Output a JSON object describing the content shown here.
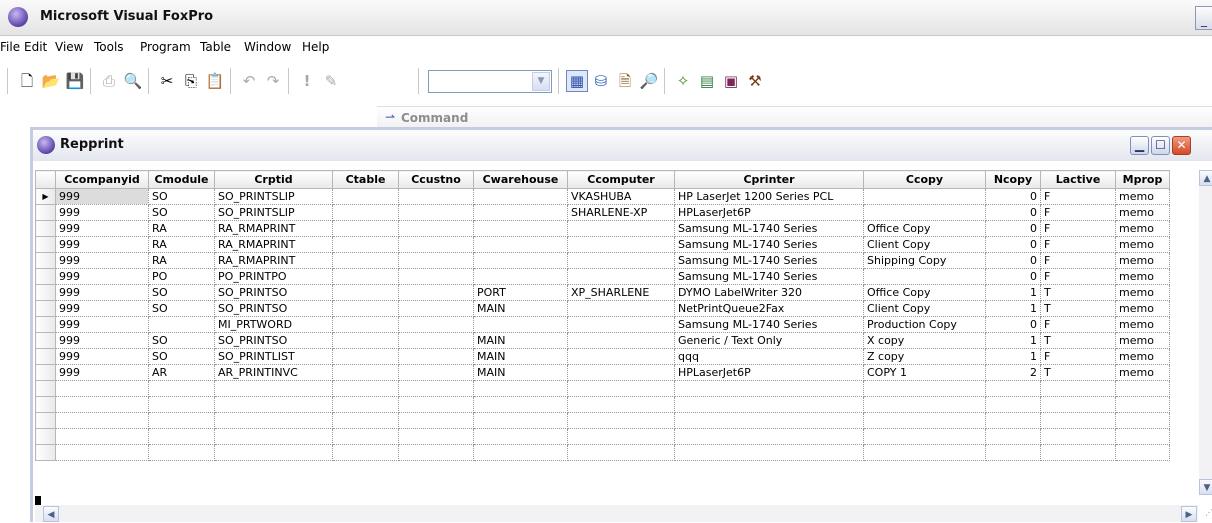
{
  "app": {
    "title": "Microsoft Visual FoxPro"
  },
  "menu": [
    "File",
    "Edit",
    "View",
    "Tools",
    "Program",
    "Table",
    "Window",
    "Help"
  ],
  "command": {
    "label": "Command"
  },
  "browse": {
    "title": "Repprint",
    "columns": [
      "Ccompanyid",
      "Cmodule",
      "Crptid",
      "Ctable",
      "Ccustno",
      "Cwarehouse",
      "Ccomputer",
      "Cprinter",
      "Ccopy",
      "Ncopy",
      "Lactive",
      "Mprop"
    ],
    "rows": [
      [
        "999",
        "SO",
        "SO_PRINTSLIP",
        "",
        "",
        "",
        "VKASHUBA",
        "HP LaserJet 1200 Series PCL",
        "",
        "0",
        "F",
        "memo"
      ],
      [
        "999",
        "SO",
        "SO_PRINTSLIP",
        "",
        "",
        "",
        "SHARLENE-XP",
        "HPLaserJet6P",
        "",
        "0",
        "F",
        "memo"
      ],
      [
        "999",
        "RA",
        "RA_RMAPRINT",
        "",
        "",
        "",
        "",
        "Samsung ML-1740 Series",
        "Office Copy",
        "0",
        "F",
        "memo"
      ],
      [
        "999",
        "RA",
        "RA_RMAPRINT",
        "",
        "",
        "",
        "",
        "Samsung ML-1740 Series",
        "Client Copy",
        "0",
        "F",
        "memo"
      ],
      [
        "999",
        "RA",
        "RA_RMAPRINT",
        "",
        "",
        "",
        "",
        "Samsung ML-1740 Series",
        "Shipping Copy",
        "0",
        "F",
        "memo"
      ],
      [
        "999",
        "PO",
        "PO_PRINTPO",
        "",
        "",
        "",
        "",
        "Samsung ML-1740 Series",
        "",
        "0",
        "F",
        "memo"
      ],
      [
        "999",
        "SO",
        "SO_PRINTSO",
        "",
        "",
        "PORT",
        "XP_SHARLENE",
        "DYMO LabelWriter 320",
        "Office Copy",
        "1",
        "T",
        "memo"
      ],
      [
        "999",
        "SO",
        "SO_PRINTSO",
        "",
        "",
        "MAIN",
        "",
        "NetPrintQueue2Fax",
        "Client Copy",
        "1",
        "T",
        "memo"
      ],
      [
        "999",
        "",
        "MI_PRTWORD",
        "",
        "",
        "",
        "",
        "Samsung ML-1740 Series",
        "Production Copy",
        "0",
        "F",
        "memo"
      ],
      [
        "999",
        "SO",
        "SO_PRINTSO",
        "",
        "",
        "MAIN",
        "",
        "Generic / Text Only",
        "X copy",
        "1",
        "T",
        "memo"
      ],
      [
        "999",
        "SO",
        "SO_PRINTLIST",
        "",
        "",
        "MAIN",
        "",
        "qqq",
        "Z copy",
        "1",
        "F",
        "memo"
      ],
      [
        "999",
        "AR",
        "AR_PRINTINVC",
        "",
        "",
        "MAIN",
        "",
        "HPLaserJet6P",
        "COPY 1",
        "2",
        "T",
        "memo"
      ]
    ],
    "empty_rows": 5
  }
}
